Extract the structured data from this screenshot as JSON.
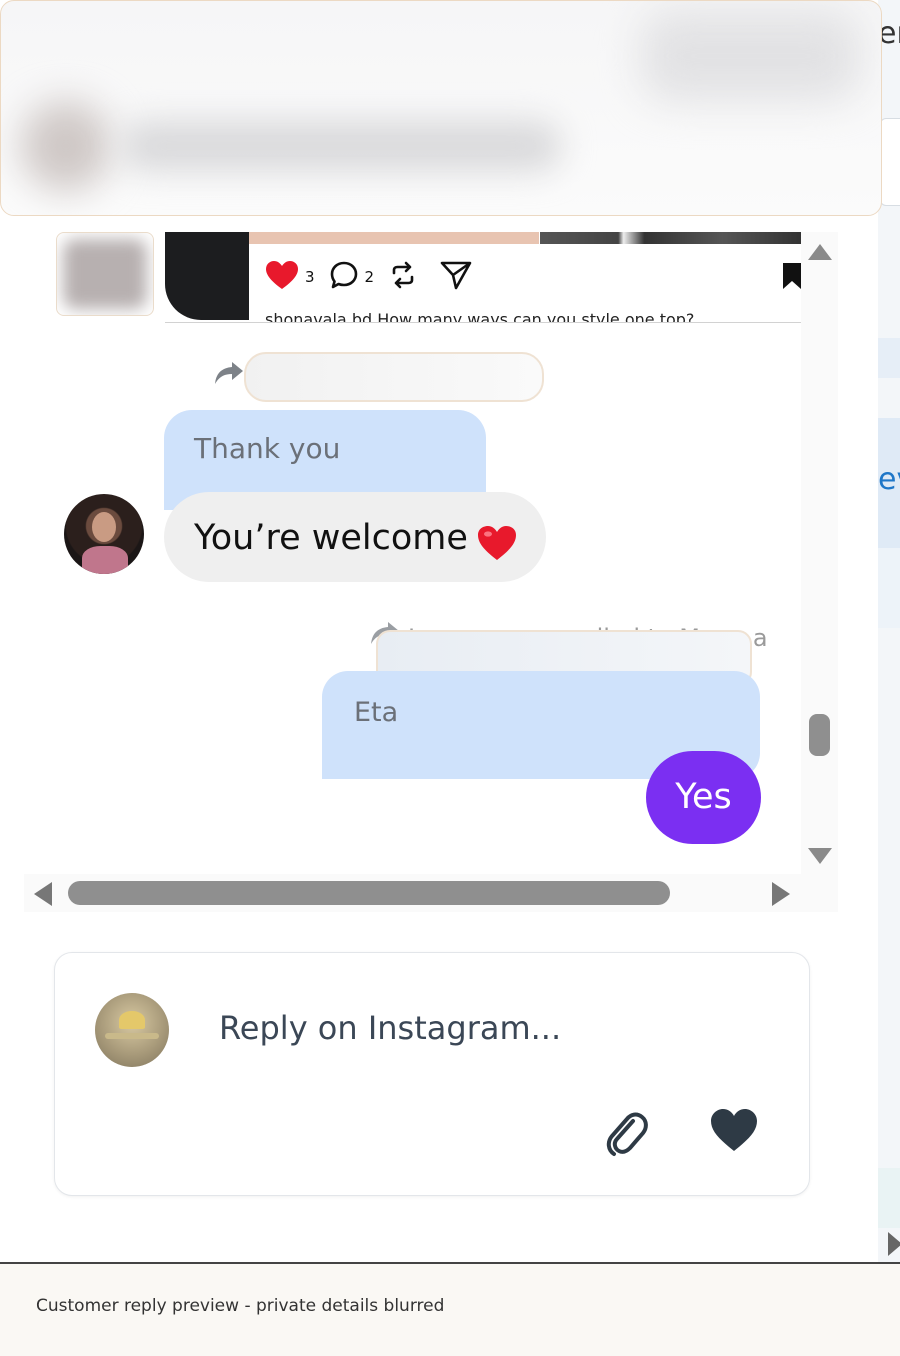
{
  "sidebar_peek": {
    "top_fragment": "er",
    "mid_fragment": "ev"
  },
  "post": {
    "like_count": "3",
    "comment_count": "2",
    "caption": "shonavala.bd How many ways can you style one top?"
  },
  "messages": {
    "thank_you": "Thank you",
    "welcome": "You’re welcome",
    "forward_note": "Lo... ... ... ... replied to Me ... a",
    "eta": "Eta",
    "yes": "Yes"
  },
  "reply": {
    "placeholder": "Reply on Instagram..."
  },
  "footer": {
    "caption": "Customer reply preview - private details blurred"
  },
  "colors": {
    "incoming_bubble": "#efefef",
    "quoted_bubble": "#cfe2fb",
    "outgoing_bubble": "#7b2ff2",
    "footer_bg": "#faf8f4"
  },
  "icons": [
    "heart-icon",
    "comment-icon",
    "repost-icon",
    "send-icon",
    "bookmark-icon",
    "forward-icon",
    "heart-emoji-icon",
    "paperclip-icon",
    "like-heart-icon"
  ]
}
